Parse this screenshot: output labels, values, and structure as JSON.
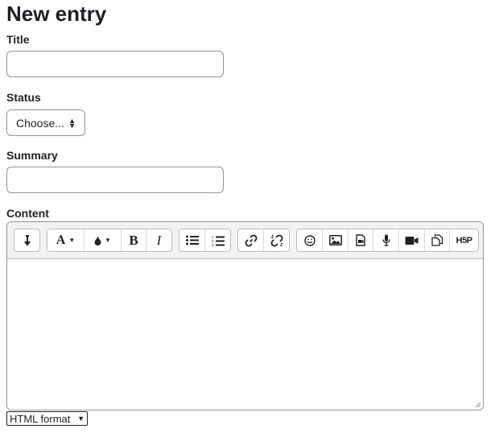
{
  "page": {
    "title": "New entry"
  },
  "form": {
    "title_label": "Title",
    "title_value": "",
    "status_label": "Status",
    "status_value": "Choose...",
    "summary_label": "Summary",
    "summary_value": "",
    "content_label": "Content",
    "content_format": "HTML format"
  },
  "toolbar": {
    "bold_label": "B",
    "italic_label": "I",
    "font_label": "A",
    "h5p_label": "H5P",
    "icons": [
      "paragraph-icon",
      "font-icon",
      "color-icon",
      "bold-icon",
      "italic-icon",
      "unordered-list-icon",
      "ordered-list-icon",
      "link-icon",
      "unlink-icon",
      "emoji-icon",
      "image-icon",
      "media-icon",
      "record-audio-icon",
      "record-video-icon",
      "manage-files-icon",
      "h5p-icon"
    ]
  },
  "colors": {
    "border": "#8f959e",
    "text": "#1d2125",
    "toolbar_bg": "#f2f2f2"
  }
}
